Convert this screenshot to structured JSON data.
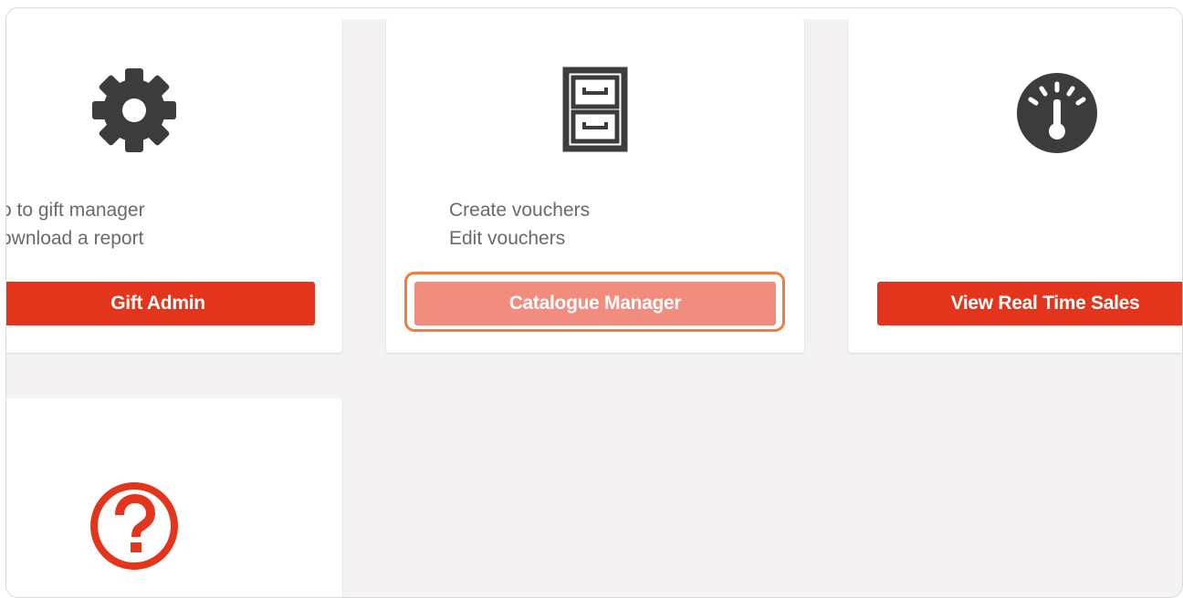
{
  "colors": {
    "accent": "#e3351b",
    "accent_hover": "#f28c7e",
    "focus_ring": "#f07d3e",
    "icon_dark": "#3c3c3c",
    "background": "#f4f2f3"
  },
  "cards": [
    {
      "icon": "gear-icon",
      "lines": [
        "o to gift manager",
        "ownload a report"
      ],
      "button_label": "Gift Admin"
    },
    {
      "icon": "filing-cabinet-icon",
      "lines": [
        "Create vouchers",
        "Edit vouchers"
      ],
      "button_label": "Catalogue Manager"
    },
    {
      "icon": "speedometer-icon",
      "lines": [],
      "button_label": "View Real Time Sales"
    },
    {
      "icon": "help-question-icon",
      "lines": [],
      "button_label": ""
    }
  ]
}
